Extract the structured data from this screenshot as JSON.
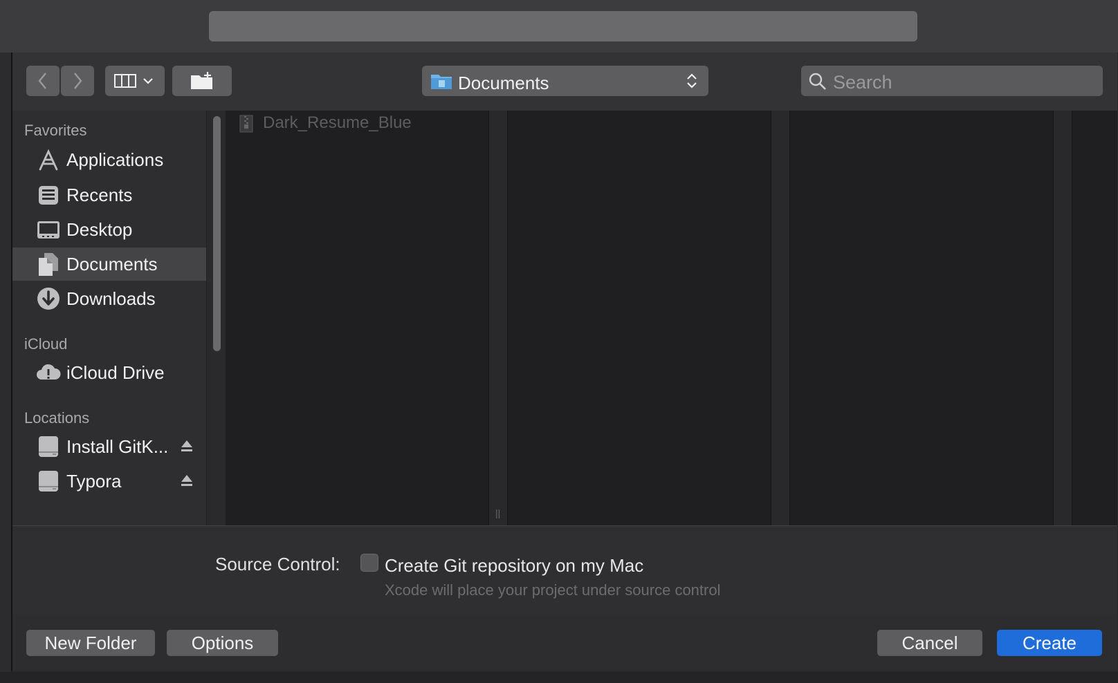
{
  "window": {
    "title": ""
  },
  "toolbar": {
    "back_icon": "chevron-left-icon",
    "forward_icon": "chevron-right-icon",
    "view_mode_icon": "column-view-icon",
    "new_folder_icon": "new-folder-icon",
    "location": "Documents",
    "search_placeholder": "Search"
  },
  "sidebar": {
    "favorites_title": "Favorites",
    "favorites": [
      {
        "label": "Applications",
        "icon": "applications-icon"
      },
      {
        "label": "Recents",
        "icon": "recents-icon"
      },
      {
        "label": "Desktop",
        "icon": "desktop-icon"
      },
      {
        "label": "Documents",
        "icon": "documents-icon",
        "selected": true
      },
      {
        "label": "Downloads",
        "icon": "downloads-icon"
      }
    ],
    "icloud_title": "iCloud",
    "icloud": [
      {
        "label": "iCloud Drive",
        "icon": "icloud-drive-icon"
      }
    ],
    "locations_title": "Locations",
    "locations": [
      {
        "label": "Install GitK...",
        "icon": "disk-icon",
        "eject": true
      },
      {
        "label": "Typora",
        "icon": "disk-icon",
        "eject": true
      }
    ]
  },
  "browser": {
    "files": [
      {
        "name": "Dark_Resume_Blue",
        "icon": "zip-file-icon",
        "disabled": true
      }
    ]
  },
  "source_control": {
    "label": "Source Control:",
    "checkbox_label": "Create Git repository on my Mac",
    "checked": false,
    "hint": "Xcode will place your project under source control"
  },
  "footer": {
    "new_folder": "New Folder",
    "options": "Options",
    "cancel": "Cancel",
    "create": "Create"
  },
  "colors": {
    "accent": "#1f6ddb"
  }
}
